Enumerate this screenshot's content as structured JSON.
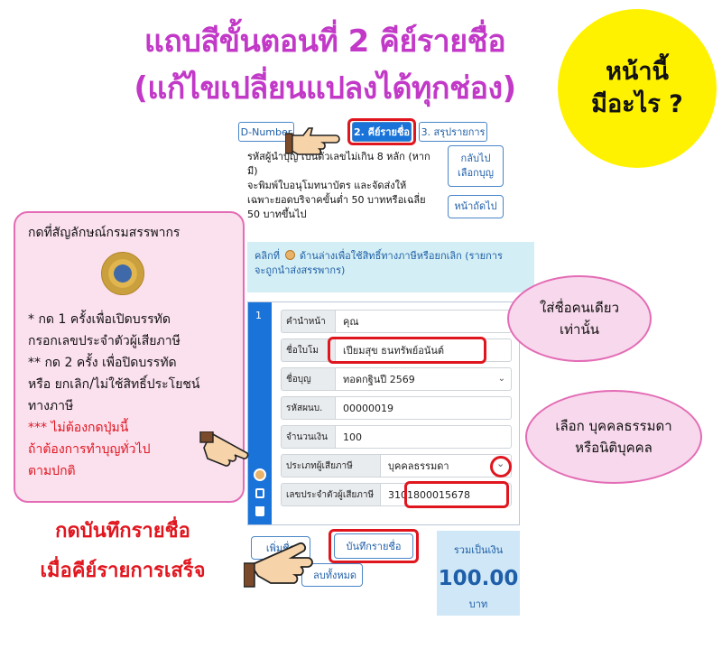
{
  "headline": {
    "line1": "แถบสีขั้นตอนที่ 2 คีย์รายชื่อ",
    "line2": "(แก้ไขเปลี่ยนแปลงได้ทุกช่อง)"
  },
  "badge": {
    "line1": "หน้านี้",
    "line2": "มีอะไร ?"
  },
  "tabs": [
    {
      "label": "D-Number"
    },
    {
      "label": "2. คีย์รายชื่อ"
    },
    {
      "label": "3. สรุปรายการ"
    }
  ],
  "intro": {
    "line1": "รหัสผู้นำบุญ เป็นตัวเลขไม่เกิน 8 หลัก (หาก",
    "line2": "มี)",
    "line3": "จะพิมพ์ใบอนุโมทนาบัตร และจัดส่งให้",
    "line4": "เฉพาะยอดบริจาคขั้นต่ำ 50 บาทหรือเฉลี่ย",
    "line5": "50 บาทขึ้นไป"
  },
  "buttons": {
    "back_line1": "กลับไป",
    "back_line2": "เลือกบุญ",
    "next": "หน้าถัดไป",
    "add": "เพิ่มชื่อ",
    "save": "บันทึกรายชื่อ",
    "clear": "ลบทั้งหมด"
  },
  "notice": {
    "before": "คลิกที่",
    "after": "ด้านล่างเพื่อใช้สิทธิ์ทางภาษีหรือยกเลิก (รายการ",
    "line2": "จะถูกนำส่งสรรพากร)"
  },
  "form": {
    "row_number": "1",
    "fields": [
      {
        "label": "คำนำหน้า",
        "value": "คุณ"
      },
      {
        "label": "ชื่อใบโม",
        "value": "เปียมสุข ธนทรัพย์อนันต์"
      },
      {
        "label": "ชื่อบุญ",
        "value": "ทอดกฐินปี 2569"
      },
      {
        "label": "รหัสผนบ.",
        "value": "00000019"
      },
      {
        "label": "จำนวนเงิน",
        "value": "100"
      },
      {
        "label": "ประเภทผู้เสียภาษี",
        "value": "บุคคลธรรมดา"
      },
      {
        "label": "เลขประจำตัวผู้เสียภาษี",
        "value": "3101800015678"
      }
    ]
  },
  "total": {
    "label": "รวมเป็นเงิน",
    "value": "100.00",
    "unit": "บาท"
  },
  "pink_note": {
    "title": "กดที่สัญลักษณ์กรมสรรพากร",
    "l1": "* กด 1 ครั้งเพื่อเปิดบรรทัด",
    "l2": "กรอกเลขประจำตัวผู้เสียภาษี",
    "l3": "** กด 2 ครั้ง เพื่อปิดบรรทัด",
    "l4": "หรือ ยกเลิก/ไม่ใช้สิทธิ์ประโยชน์",
    "l5": "ทางภาษี",
    "l6": "*** ไม่ต้องกดปุ่มนี้",
    "l7": "ถ้าต้องการทำบุญทั่วไป",
    "l8": "ตามปกติ"
  },
  "bubble_name": {
    "line1": "ใส่ชื่อคนเดียว",
    "line2": "เท่านั้น"
  },
  "bubble_type": {
    "line1": "เลือก บุคคลธรรมดา",
    "line2": "หรือนิติบุคคล"
  },
  "save_caption": {
    "line1": "กดบันทึกรายชื่อ",
    "line2": "เมื่อคีย์รายการเสร็จ"
  },
  "colors": {
    "headline": "#c239c8",
    "badge": "#fff200",
    "highlight": "#e0161f",
    "primary": "#1a73d9",
    "pink_fill": "#fbe0ee",
    "pink_border": "#e36cb5"
  },
  "icons": [
    "revenue-seal-icon",
    "pointing-hand-icon",
    "copy-icon",
    "trash-icon",
    "chevron-down-icon"
  ]
}
